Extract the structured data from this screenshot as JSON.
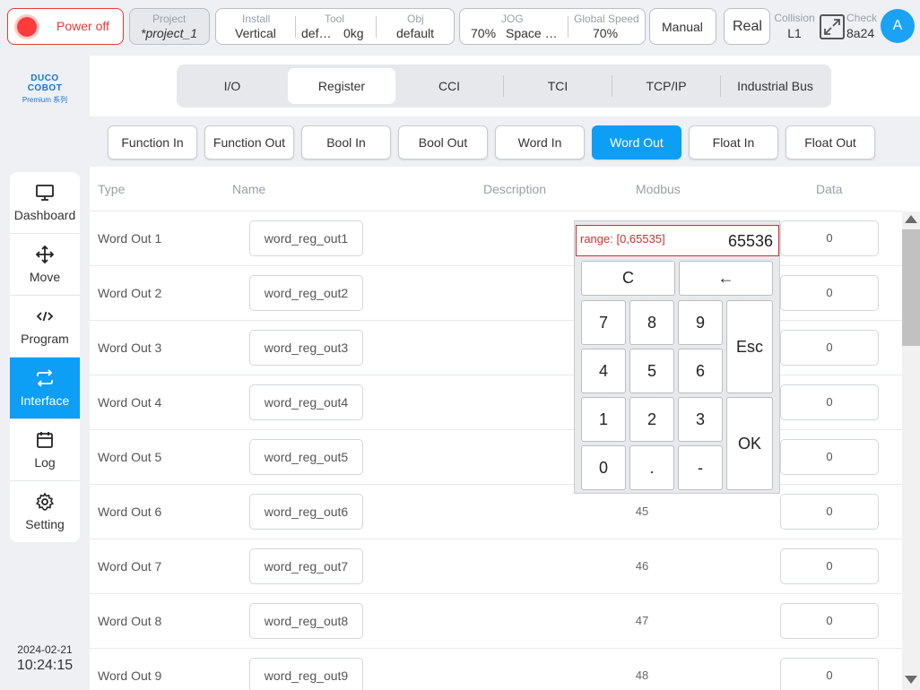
{
  "topbar": {
    "power_label": "Power off",
    "project_caption": "Project",
    "project_value": "*project_1",
    "install_caption": "Install",
    "install_value": "Vertical",
    "tool_caption": "Tool",
    "tool_value": "def…",
    "tool_weight": "0kg",
    "obj_caption": "Obj",
    "obj_value": "default",
    "jog_caption": "JOG",
    "jog_speed": "70%",
    "jog_space": "Space …",
    "global_speed_caption": "Global Speed",
    "global_speed_value": "70%",
    "mode_button": "Manual",
    "real_button": "Real",
    "collision_caption": "Collision",
    "collision_value": "L1",
    "check_caption": "Check",
    "check_value": "8a24",
    "avatar_letter": "A"
  },
  "logo": {
    "brand": "DUCO COBOT",
    "series": "Premium 系列"
  },
  "nav": {
    "items": [
      {
        "label": "Dashboard",
        "icon": "monitor-icon"
      },
      {
        "label": "Move",
        "icon": "move-arrows-icon"
      },
      {
        "label": "Program",
        "icon": "code-icon"
      },
      {
        "label": "Interface",
        "icon": "swap-arrows-icon"
      },
      {
        "label": "Log",
        "icon": "calendar-icon"
      },
      {
        "label": "Setting",
        "icon": "gear-icon"
      }
    ],
    "active": "Interface"
  },
  "datetime": {
    "date": "2024-02-21",
    "time": "10:24:15"
  },
  "tabs": [
    "I/O",
    "Register",
    "CCI",
    "TCI",
    "TCP/IP",
    "Industrial Bus"
  ],
  "active_tab": "Register",
  "subtabs": [
    "Function In",
    "Function Out",
    "Bool In",
    "Bool Out",
    "Word In",
    "Word Out",
    "Float In",
    "Float Out"
  ],
  "active_subtab": "Word Out",
  "table": {
    "headers": {
      "type": "Type",
      "name": "Name",
      "description": "Description",
      "modbus": "Modbus",
      "data": "Data"
    },
    "rows": [
      {
        "type": "Word Out 1",
        "name": "word_reg_out1",
        "modbus": "",
        "data": "0"
      },
      {
        "type": "Word Out 2",
        "name": "word_reg_out2",
        "modbus": "",
        "data": "0"
      },
      {
        "type": "Word Out 3",
        "name": "word_reg_out3",
        "modbus": "",
        "data": "0"
      },
      {
        "type": "Word Out 4",
        "name": "word_reg_out4",
        "modbus": "",
        "data": "0"
      },
      {
        "type": "Word Out 5",
        "name": "word_reg_out5",
        "modbus": "",
        "data": "0"
      },
      {
        "type": "Word Out 6",
        "name": "word_reg_out6",
        "modbus": "45",
        "data": "0"
      },
      {
        "type": "Word Out 7",
        "name": "word_reg_out7",
        "modbus": "46",
        "data": "0"
      },
      {
        "type": "Word Out 8",
        "name": "word_reg_out8",
        "modbus": "47",
        "data": "0"
      },
      {
        "type": "Word Out 9",
        "name": "word_reg_out9",
        "modbus": "48",
        "data": "0"
      }
    ]
  },
  "keypad": {
    "range": "range: [0,65535]",
    "value": "65536",
    "keys": {
      "clear": "C",
      "backspace": "←",
      "k7": "7",
      "k8": "8",
      "k9": "9",
      "esc": "Esc",
      "k4": "4",
      "k5": "5",
      "k6": "6",
      "k1": "1",
      "k2": "2",
      "k3": "3",
      "ok": "OK",
      "k0": "0",
      "dot": ".",
      "minus": "-"
    }
  }
}
